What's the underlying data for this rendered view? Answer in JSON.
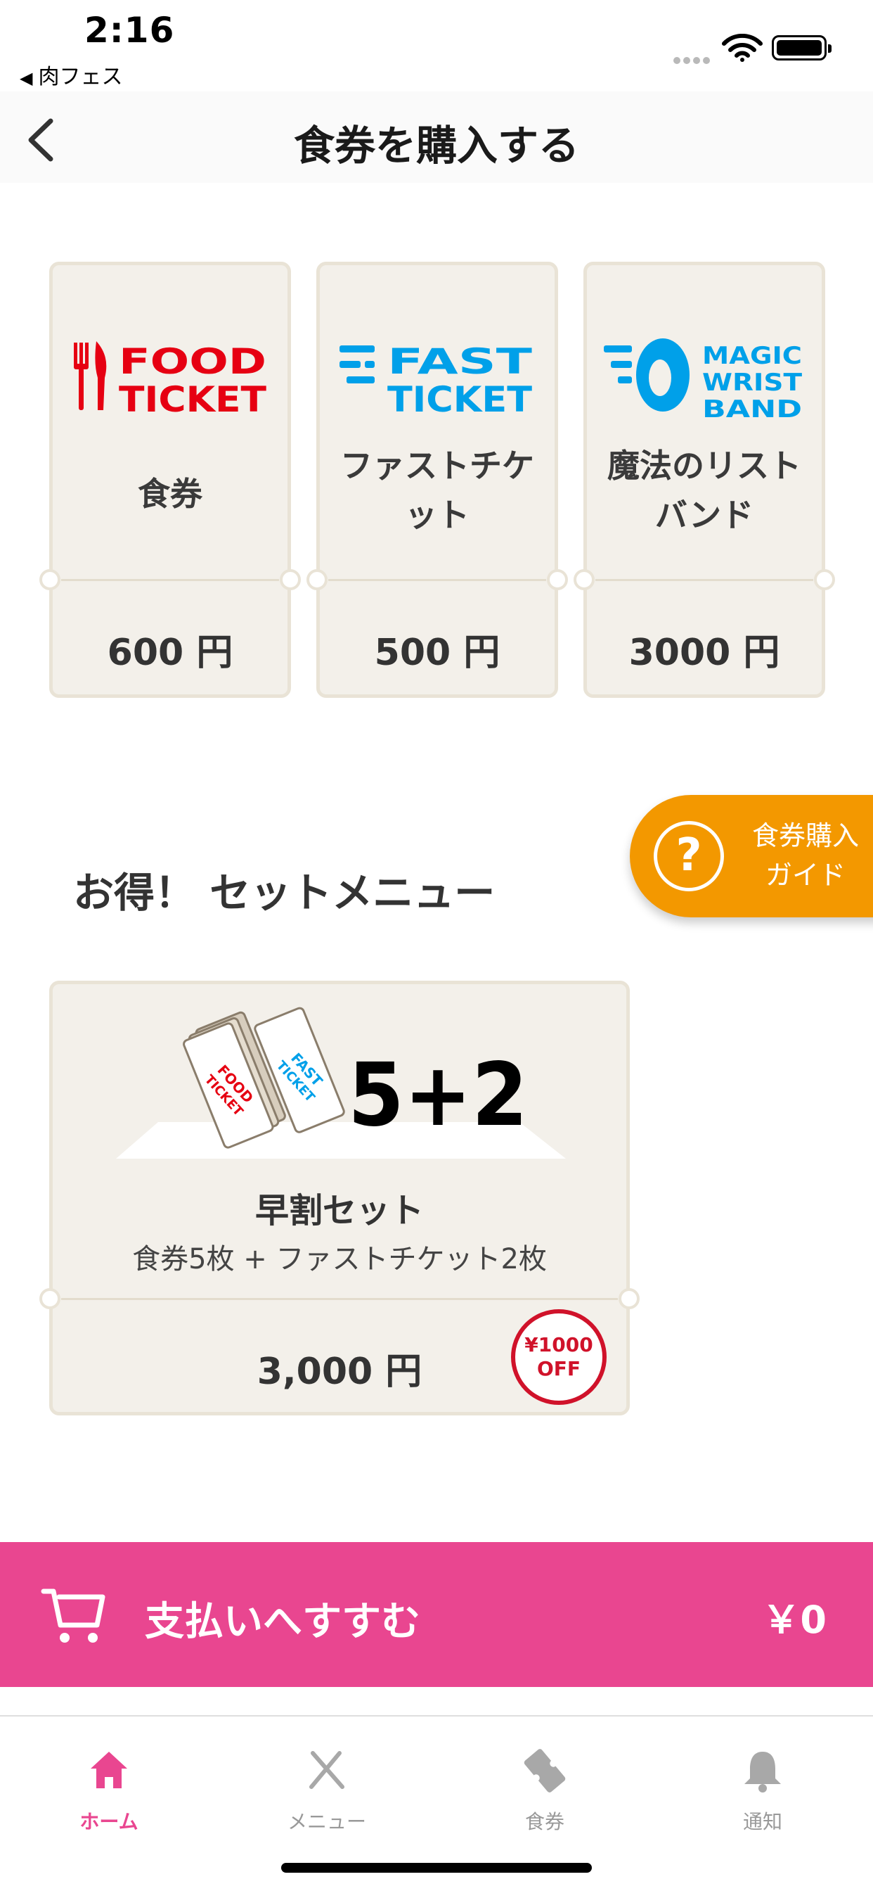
{
  "status_bar": {
    "time": "2:16",
    "back_app": "肉フェス"
  },
  "nav": {
    "title": "食券を購入する"
  },
  "tickets": [
    {
      "logo_line1": "FOOD",
      "logo_line2": "TICKET",
      "logo_color": "#e60012",
      "name": "食券",
      "price": "600 円"
    },
    {
      "logo_line1": "FAST",
      "logo_line2": "TICKET",
      "logo_color": "#00a0e9",
      "name_line1": "ファストチケ",
      "name_line2": "ット",
      "price": "500 円"
    },
    {
      "logo_line1": "MAGIC",
      "logo_line2": "WRIST",
      "logo_line3": "BAND",
      "logo_color": "#00a0e9",
      "name_line1": "魔法のリスト",
      "name_line2": "バンド",
      "price": "3000 円"
    }
  ],
  "guide": {
    "icon": "question-icon",
    "line1": "食券購入",
    "line2": "ガイド"
  },
  "set_section": {
    "title": "お得！ セットメニュー"
  },
  "set_menu": {
    "hero_food_1": "FOOD",
    "hero_food_2": "TICKET",
    "hero_fast_1": "FAST",
    "hero_fast_2": "TICKET",
    "hero_count": "5+2",
    "name": "早割セット",
    "description": "食券5枚 + ファストチケット2枚",
    "price": "3,000 円",
    "discount_line1": "¥1000",
    "discount_line2": "OFF"
  },
  "checkout": {
    "icon": "cart-icon",
    "label": "支払いへすすむ",
    "total": "￥0"
  },
  "tabbar": {
    "tabs": [
      {
        "label": "ホーム",
        "icon": "home-icon",
        "active": true
      },
      {
        "label": "メニュー",
        "icon": "utensils-icon",
        "active": false
      },
      {
        "label": "食券",
        "icon": "ticket-icon",
        "active": false
      },
      {
        "label": "通知",
        "icon": "bell-icon",
        "active": false
      }
    ]
  },
  "colors": {
    "accent": "#e94690",
    "guide": "#f39800",
    "food_red": "#e60012",
    "fast_blue": "#00a0e9",
    "card_bg": "#f3f0ea"
  }
}
